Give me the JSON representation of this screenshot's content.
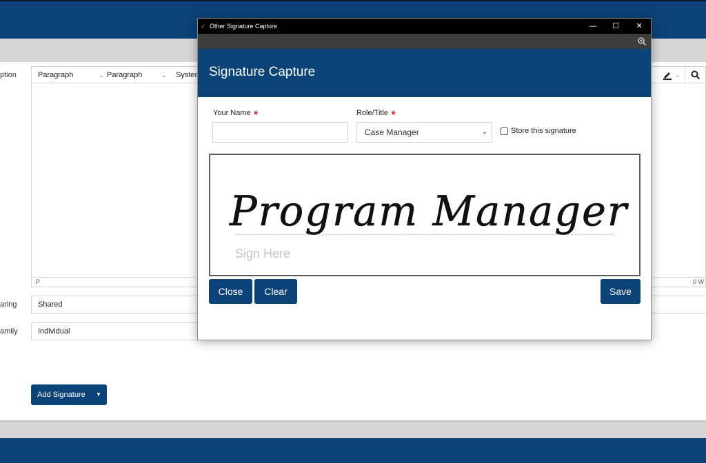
{
  "background_app": {
    "labels": {
      "description": "ption",
      "sharing": "aring",
      "family": "amily"
    },
    "editor": {
      "toolbar": {
        "dropdown_1": "Paragraph",
        "dropdown_2": "Paragraph",
        "dropdown_3": "System"
      },
      "status_path": "P",
      "status_words": "0 W"
    },
    "sharing_value": "Shared",
    "family_value": "Individual",
    "add_signature_label": "Add Signature"
  },
  "dialog": {
    "window_title": "Other Signature Capture",
    "window_buttons": {
      "minimize": "—",
      "maximize": "☐",
      "close": "✕"
    },
    "header_title": "Signature Capture",
    "your_name": {
      "label": "Your Name",
      "value": "",
      "required": true
    },
    "role_title": {
      "label": "Role/Title",
      "selected": "Case Manager",
      "required": true
    },
    "store_signature": {
      "label": "Store this signature",
      "checked": false
    },
    "signature_text": "Program Manager",
    "sign_here": "Sign Here",
    "buttons": {
      "close": "Close",
      "clear": "Clear",
      "save": "Save"
    }
  },
  "colors": {
    "brand_blue": "#0b4277",
    "required_star": "#d62828",
    "titlebar": "#000000"
  },
  "icons": [
    "app-icon",
    "zoom-icon",
    "chevron-down-icon",
    "highlighter-icon",
    "search-icon",
    "caret-down-icon",
    "star-icon"
  ]
}
